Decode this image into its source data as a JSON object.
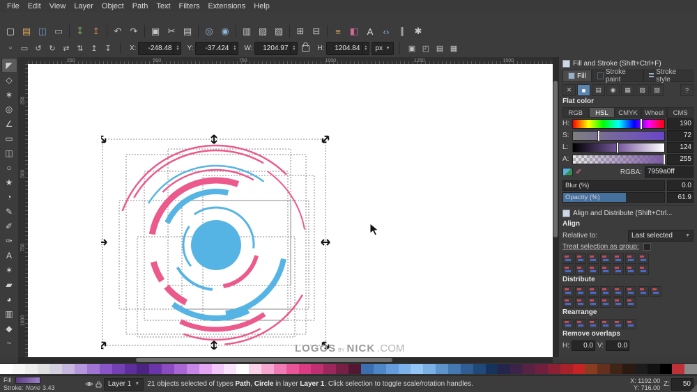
{
  "menu": {
    "items": [
      "File",
      "Edit",
      "View",
      "Layer",
      "Object",
      "Path",
      "Text",
      "Filters",
      "Extensions",
      "Help"
    ]
  },
  "commands": {
    "icons": [
      {
        "name": "new-document-icon",
        "glyph": "▢",
        "color": "#dcdcdc"
      },
      {
        "name": "open-document-icon",
        "glyph": "▤",
        "color": "#d9a85c"
      },
      {
        "name": "save-document-icon",
        "glyph": "◫",
        "color": "#6f94c9"
      },
      {
        "name": "print-icon",
        "glyph": "▭",
        "color": "#aab0b6"
      },
      {
        "sep": true
      },
      {
        "name": "import-icon",
        "glyph": "↧",
        "color": "#84b05c"
      },
      {
        "name": "export-icon",
        "glyph": "↥",
        "color": "#c57f52"
      },
      {
        "sep": true
      },
      {
        "name": "undo-icon",
        "glyph": "↶",
        "color": "#c8c8c8"
      },
      {
        "name": "redo-icon",
        "glyph": "↷",
        "color": "#c8c8c8"
      },
      {
        "sep": true
      },
      {
        "name": "copy-icon",
        "glyph": "▣",
        "color": "#c8c8c8"
      },
      {
        "name": "cut-icon",
        "glyph": "✂",
        "color": "#c8c8c8"
      },
      {
        "name": "paste-icon",
        "glyph": "▤",
        "color": "#c8c8c8"
      },
      {
        "sep": true
      },
      {
        "name": "zoom-drawing-icon",
        "glyph": "◎",
        "color": "#90b6da"
      },
      {
        "name": "zoom-selection-icon",
        "glyph": "◉",
        "color": "#90b6da"
      },
      {
        "sep": true
      },
      {
        "name": "duplicate-icon",
        "glyph": "▥",
        "color": "#c8c8c8"
      },
      {
        "name": "clone-icon",
        "glyph": "▧",
        "color": "#c8c8c8"
      },
      {
        "name": "unlink-clone-icon",
        "glyph": "▨",
        "color": "#c8c8c8"
      },
      {
        "sep": true
      },
      {
        "name": "group-icon",
        "glyph": "⊞",
        "color": "#c8c8c8"
      },
      {
        "name": "ungroup-icon",
        "glyph": "⊟",
        "color": "#c8c8c8"
      },
      {
        "sep": true
      },
      {
        "name": "layers-dialog-icon",
        "glyph": "≡",
        "color": "#cfa05e"
      },
      {
        "name": "fill-stroke-dialog-icon",
        "glyph": "◧",
        "color": "#d06a9a"
      },
      {
        "name": "text-dialog-icon",
        "glyph": "A",
        "color": "#dcdcdc"
      },
      {
        "name": "xml-editor-icon",
        "glyph": "‹›",
        "color": "#8fb4d8"
      },
      {
        "name": "align-dialog-icon",
        "glyph": "∥",
        "color": "#c8c8c8"
      },
      {
        "name": "preferences-icon",
        "glyph": "✱",
        "color": "#c8c8c8"
      }
    ]
  },
  "tool_options": {
    "left_icons": [
      {
        "name": "select-all-icon",
        "glyph": "▫"
      },
      {
        "name": "select-all-layers-icon",
        "glyph": "▭"
      },
      {
        "name": "rotate-ccw-icon",
        "glyph": "↺"
      },
      {
        "name": "rotate-cw-icon",
        "glyph": "↻"
      },
      {
        "name": "flip-horizontal-icon",
        "glyph": "⇄"
      },
      {
        "name": "flip-vertical-icon",
        "glyph": "⇅"
      },
      {
        "name": "raise-to-top-icon",
        "glyph": "↥"
      },
      {
        "name": "lower-to-bottom-icon",
        "glyph": "↧"
      }
    ],
    "x_label": "X:",
    "x_value": "-248.48",
    "y_label": "Y:",
    "y_value": "-37.424",
    "w_label": "W:",
    "w_value": "1204.97",
    "h_label": "H:",
    "h_value": "1204.84",
    "unit": "px",
    "affect_icons": [
      {
        "name": "scale-stroke-toggle",
        "glyph": "▣"
      },
      {
        "name": "scale-corners-toggle",
        "glyph": "◰"
      },
      {
        "name": "move-gradients-toggle",
        "glyph": "▤"
      },
      {
        "name": "move-patterns-toggle",
        "glyph": "▦"
      }
    ]
  },
  "toolbox": {
    "tools": [
      {
        "name": "selector-tool",
        "glyph": "◤"
      },
      {
        "name": "node-tool",
        "glyph": "◇"
      },
      {
        "name": "tweak-tool",
        "glyph": "∗"
      },
      {
        "name": "zoom-tool",
        "glyph": "◎"
      },
      {
        "name": "measure-tool",
        "glyph": "∠"
      },
      {
        "name": "rectangle-tool",
        "glyph": "▭"
      },
      {
        "name": "box3d-tool",
        "glyph": "◫"
      },
      {
        "name": "ellipse-tool",
        "glyph": "○"
      },
      {
        "name": "star-tool",
        "glyph": "★"
      },
      {
        "name": "spiral-tool",
        "glyph": "◔"
      },
      {
        "name": "pencil-tool",
        "glyph": "✎"
      },
      {
        "name": "pen-tool",
        "glyph": "✐"
      },
      {
        "name": "calligraphy-tool",
        "glyph": "✑"
      },
      {
        "name": "text-tool",
        "glyph": "A"
      },
      {
        "name": "spray-tool",
        "glyph": "✶"
      },
      {
        "name": "eraser-tool",
        "glyph": "▰"
      },
      {
        "name": "bucket-tool",
        "glyph": "◕"
      },
      {
        "name": "gradient-tool",
        "glyph": "▥"
      },
      {
        "name": "dropper-tool",
        "glyph": "◆"
      },
      {
        "name": "connector-tool",
        "glyph": "~"
      }
    ]
  },
  "rulers": {
    "h_labels": [
      "250",
      "500",
      "750",
      "1000",
      "1250",
      "1500"
    ],
    "v_labels": [
      "250",
      "500",
      "750",
      "1000"
    ]
  },
  "artwork": {
    "pink": "#ec5a8c",
    "blue": "#56b4e4"
  },
  "canvas": {
    "watermark": {
      "logos": "LOGOS",
      "by": "BY",
      "nick": "NICK",
      "com": ".COM"
    }
  },
  "fill_stroke": {
    "title": "Fill and Stroke (Shift+Ctrl+F)",
    "tabs": [
      {
        "label": "Fill"
      },
      {
        "label": "Stroke paint"
      },
      {
        "label": "Stroke style"
      }
    ],
    "paint_modes": [
      {
        "name": "no-paint-icon",
        "glyph": "✕"
      },
      {
        "name": "flat-color-icon",
        "glyph": "■",
        "active": true
      },
      {
        "name": "linear-gradient-icon",
        "glyph": "▤"
      },
      {
        "name": "radial-gradient-icon",
        "glyph": "◉"
      },
      {
        "name": "pattern-icon",
        "glyph": "▦"
      },
      {
        "name": "swatch-icon",
        "glyph": "▧"
      },
      {
        "name": "unknown-paint-icon",
        "glyph": "▨"
      },
      {
        "name": "paint-help-icon",
        "glyph": "?"
      }
    ],
    "flat_color_label": "Flat color",
    "color_tabs": [
      "RGB",
      "HSL",
      "CMYK",
      "Wheel",
      "CMS"
    ],
    "sliders": [
      {
        "label": "H:",
        "value": "190"
      },
      {
        "label": "S:",
        "value": "72"
      },
      {
        "label": "L:",
        "value": "124"
      },
      {
        "label": "A:",
        "value": "255"
      }
    ],
    "rgba_label": "RGBA:",
    "rgba_value": "7959a0ff",
    "blur_label": "Blur (%)",
    "blur_value": "0.0",
    "opacity_label": "Opacity (%)",
    "opacity_value": "61.9"
  },
  "align": {
    "title": "Align and Distribute (Shift+Ctrl...",
    "align_label": "Align",
    "relative_label": "Relative to:",
    "relative_value": "Last selected",
    "group_label": "Treat selection as group:",
    "align_icons_row1": [
      "align-right-to-left-edge",
      "align-left-edges",
      "center-on-vertical-axis",
      "align-right-edges",
      "align-left-to-right-edge",
      "text-align-horizontal",
      "align-horizontal-node"
    ],
    "align_icons_row2": [
      "align-bottom-to-top-edge",
      "align-top-edges",
      "center-on-horizontal-axis",
      "align-bottom-edges",
      "align-top-to-bottom-edge",
      "text-align-vertical",
      "align-vertical-node"
    ],
    "distribute_label": "Distribute",
    "distribute_icons_row1": [
      "distribute-left-edges",
      "distribute-centers-horizontally",
      "distribute-right-edges",
      "distribute-horizontal-gaps",
      "distribute-top-edges",
      "distribute-centers-vertically",
      "distribute-bottom-edges",
      "distribute-vertical-gaps"
    ],
    "distribute_icons_row2": [
      "text-baselines-horizontal",
      "text-baselines-vertical",
      "make-horizontal-gaps-equal",
      "make-vertical-gaps-equal",
      "center-horizontally",
      "center-vertically"
    ],
    "rearrange_label": "Rearrange",
    "rearrange_icons": [
      "graph-layout",
      "exchange-selection-order",
      "exchange-stacking-order",
      "rotate-90-ccw",
      "randomize-positions",
      "unclump-objects"
    ],
    "remove_overlaps_label": "Remove overlaps",
    "h_label": "H:",
    "h_value": "0.0",
    "v_label": "V:",
    "v_value": "0.0"
  },
  "palette": {
    "colors": [
      "#ffffff",
      "#f7f7f7",
      "#ededed",
      "#e0e0e0",
      "#d5d0e0",
      "#c7b8e0",
      "#b497dc",
      "#a076d4",
      "#8a55c8",
      "#7440b4",
      "#5e2f9a",
      "#4a2480",
      "#6a35a8",
      "#8a4cc0",
      "#aa66d4",
      "#c886e6",
      "#e2a6f2",
      "#f2c6f8",
      "#fae2fa",
      "#ffffff",
      "#fbd3e8",
      "#f6a8d0",
      "#ef7cb4",
      "#e85698",
      "#da3c84",
      "#c03070",
      "#9c275a",
      "#772045",
      "#521733",
      "#3b6fb0",
      "#4f86c8",
      "#659cdc",
      "#7cb2ec",
      "#93c6f6",
      "#7ab0e4",
      "#5d94cc",
      "#4478b0",
      "#305e94",
      "#204878",
      "#16335c",
      "#25244a",
      "#3d2347",
      "#572243",
      "#70203c",
      "#8c2034",
      "#a8222c",
      "#c42424",
      "#8a3c20",
      "#62301c",
      "#402417",
      "#2a1a12",
      "#1c1c1c",
      "#111111",
      "#000000",
      "#c03038",
      "#8a8a8a"
    ]
  },
  "statusbar": {
    "fill_label": "Fill:",
    "fill_swatch_style": "linear-gradient(90deg,#5b3f86,#9b7fc4)",
    "stroke_label": "Stroke:",
    "stroke_value": "None",
    "stroke_width": "3.43",
    "layer_label": "Layer 1",
    "message": {
      "p1": "21 objects selected of types ",
      "b1": "Path",
      "p2": ", ",
      "b2": "Circle",
      "p3": " in layer ",
      "b3": "Layer 1",
      "p4": ". Click selection to toggle scale/rotation handles."
    },
    "x_label": "X:",
    "x_value": "1192.00",
    "y_label": "Y:",
    "y_value": "716.00",
    "z_label": "Z:",
    "z_value": "50"
  }
}
